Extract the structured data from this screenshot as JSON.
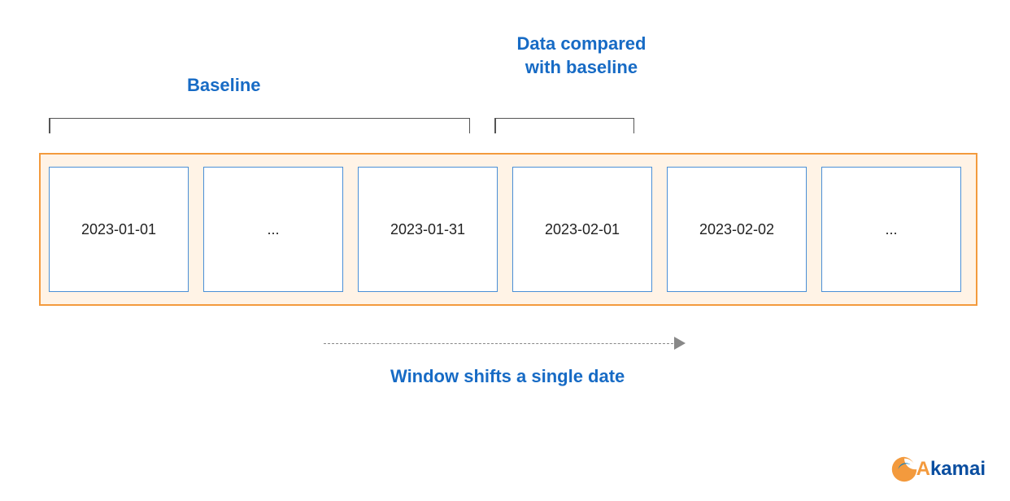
{
  "labels": {
    "baseline": "Baseline",
    "compared": "Data compared with baseline",
    "shift": "Window shifts a single date"
  },
  "cells": {
    "c0": "2023-01-01",
    "c1": "...",
    "c2": "2023-01-31",
    "c3": "2023-02-01",
    "c4": "2023-02-02",
    "c5": "..."
  },
  "logo": {
    "brand": "Akamai"
  },
  "colors": {
    "accent_blue": "#176bc5",
    "box_border": "#f39a3d",
    "box_bg": "#fff3e6",
    "cell_border": "#4a8fd6"
  }
}
